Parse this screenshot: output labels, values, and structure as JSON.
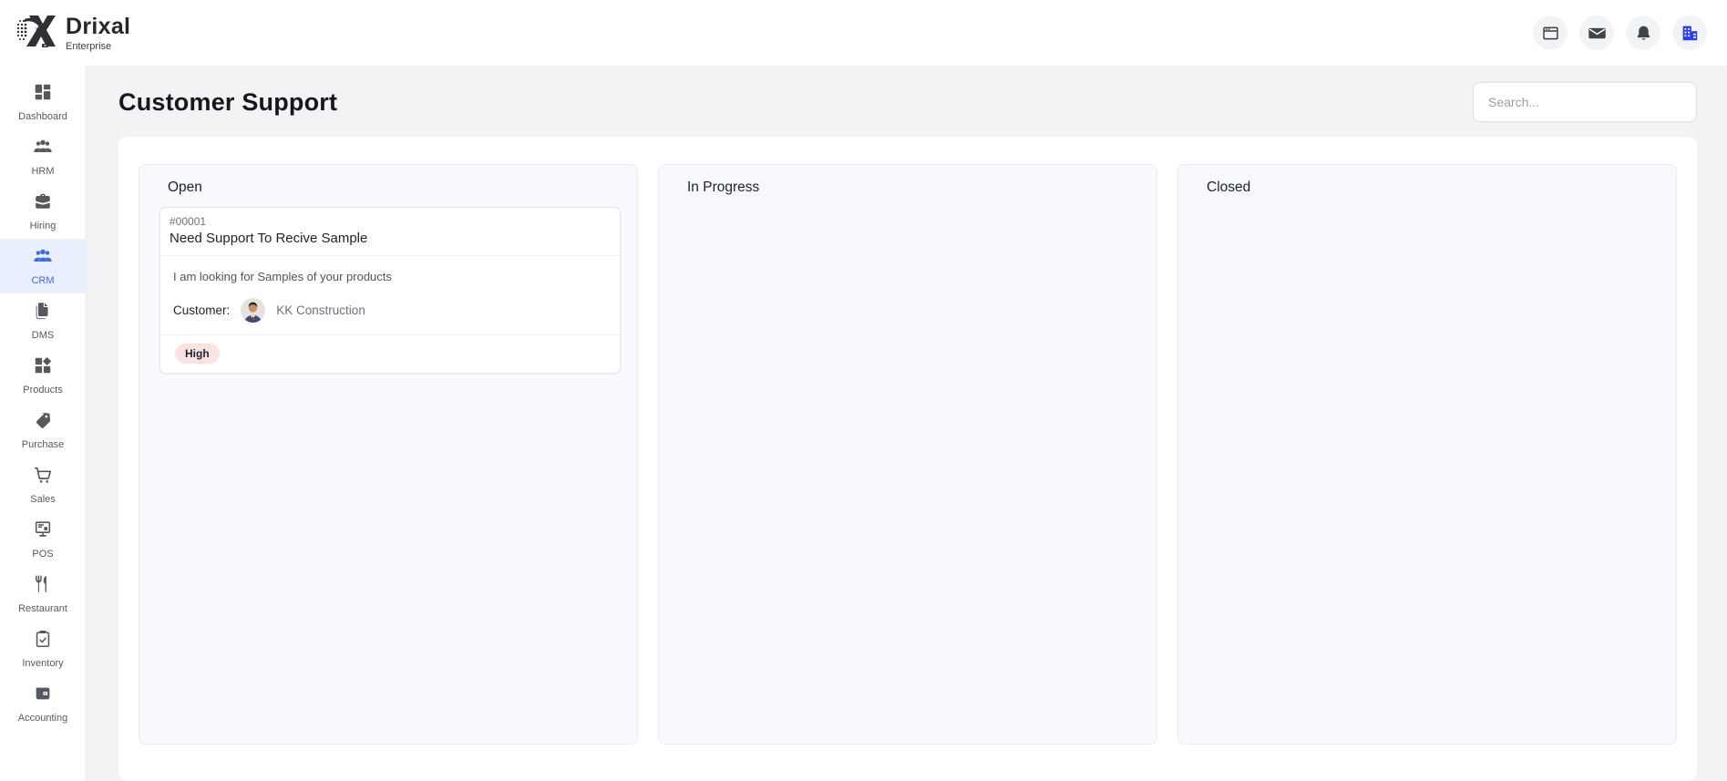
{
  "brand": {
    "name": "Drixal",
    "subtitle": "Enterprise"
  },
  "header": {
    "icons": [
      {
        "name": "window"
      },
      {
        "name": "mail"
      },
      {
        "name": "notifications"
      },
      {
        "name": "company"
      }
    ]
  },
  "sidebar": {
    "items": [
      {
        "label": "Dashboard",
        "icon": "dashboard-icon",
        "active": false
      },
      {
        "label": "HRM",
        "icon": "people-icon",
        "active": false
      },
      {
        "label": "Hiring",
        "icon": "briefcase-icon",
        "active": false
      },
      {
        "label": "CRM",
        "icon": "people-icon",
        "active": true
      },
      {
        "label": "DMS",
        "icon": "document-icon",
        "active": false
      },
      {
        "label": "Products",
        "icon": "grid-diamond-icon",
        "active": false
      },
      {
        "label": "Purchase",
        "icon": "tag-icon",
        "active": false
      },
      {
        "label": "Sales",
        "icon": "cart-icon",
        "active": false
      },
      {
        "label": "POS",
        "icon": "register-icon",
        "active": false
      },
      {
        "label": "Restaurant",
        "icon": "cutlery-icon",
        "active": false
      },
      {
        "label": "Inventory",
        "icon": "clipboard-check-icon",
        "active": false
      },
      {
        "label": "Accounting",
        "icon": "wallet-icon",
        "active": false
      }
    ]
  },
  "page": {
    "title": "Customer Support",
    "search_placeholder": "Search..."
  },
  "board": {
    "columns": [
      {
        "title": "Open",
        "tickets": [
          {
            "id": "#00001",
            "title": "Need Support To Recive Sample",
            "description": "I am looking for Samples of your products",
            "customer_label": "Customer:",
            "customer_name": "KK Construction",
            "priority": "High"
          }
        ]
      },
      {
        "title": "In Progress",
        "tickets": []
      },
      {
        "title": "Closed",
        "tickets": []
      }
    ]
  },
  "colors": {
    "accent": "#3b6be4",
    "active_item_bg": "#e9effc",
    "priority_high_bg": "#fbe3e3",
    "priority_high_text": "#1f2430",
    "company_icon_blue": "#2b3deb",
    "main_background": "#f2f3f5"
  }
}
